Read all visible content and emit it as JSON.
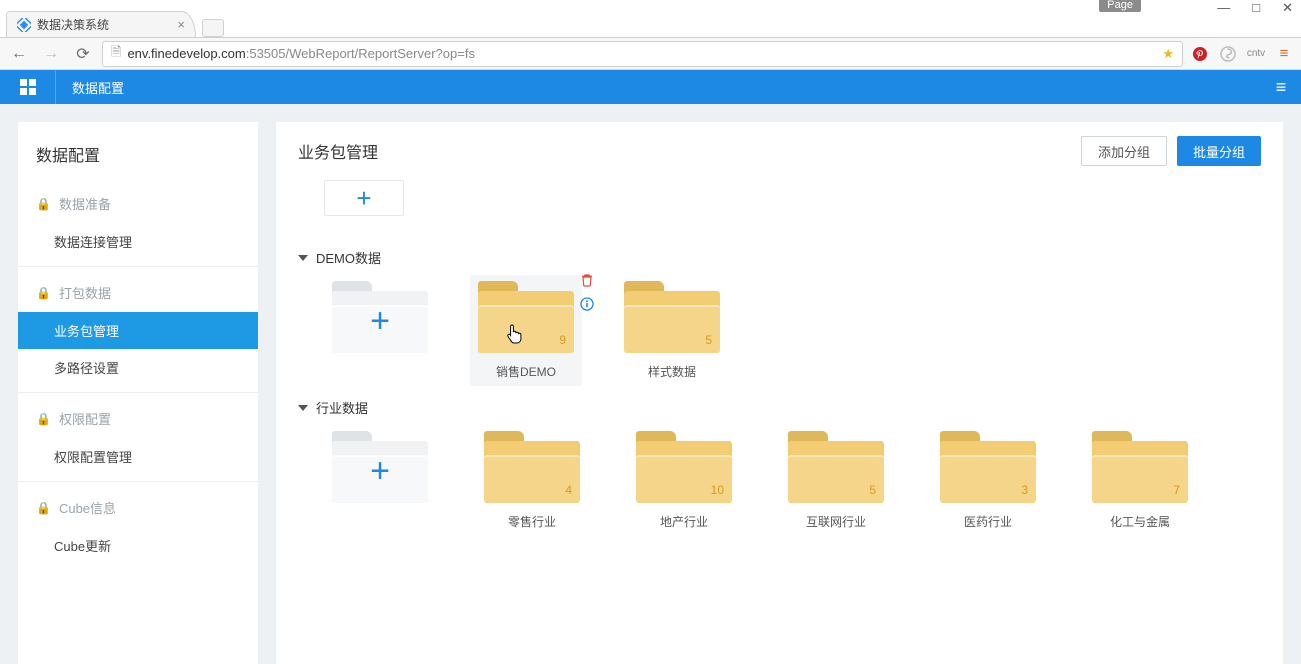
{
  "browser": {
    "page_button": "Page",
    "tab_title": "数据决策系统",
    "url_host": "env.finedevelop.com",
    "url_port": ":53505",
    "url_path": "/WebReport/ReportServer?op=fs",
    "ext_cntv": "cntv"
  },
  "appbar": {
    "crumb": "数据配置"
  },
  "sidebar": {
    "title": "数据配置",
    "sections": [
      {
        "head": "数据准备",
        "items": [
          "数据连接管理"
        ]
      },
      {
        "head": "打包数据",
        "items": [
          "业务包管理",
          "多路径设置"
        ]
      },
      {
        "head": "权限配置",
        "items": [
          "权限配置管理"
        ]
      },
      {
        "head": "Cube信息",
        "items": [
          "Cube更新"
        ]
      }
    ],
    "active": "业务包管理"
  },
  "main": {
    "title": "业务包管理",
    "btn_add_group": "添加分组",
    "btn_batch_group": "批量分组",
    "groups": [
      {
        "name": "DEMO数据",
        "packages": [
          {
            "label": "销售DEMO",
            "count": 9,
            "hovered": true
          },
          {
            "label": "样式数据",
            "count": 5
          }
        ]
      },
      {
        "name": "行业数据",
        "packages": [
          {
            "label": "零售行业",
            "count": 4
          },
          {
            "label": "地产行业",
            "count": 10
          },
          {
            "label": "互联网行业",
            "count": 5
          },
          {
            "label": "医药行业",
            "count": 3
          },
          {
            "label": "化工与金属",
            "count": 7
          }
        ]
      }
    ]
  }
}
